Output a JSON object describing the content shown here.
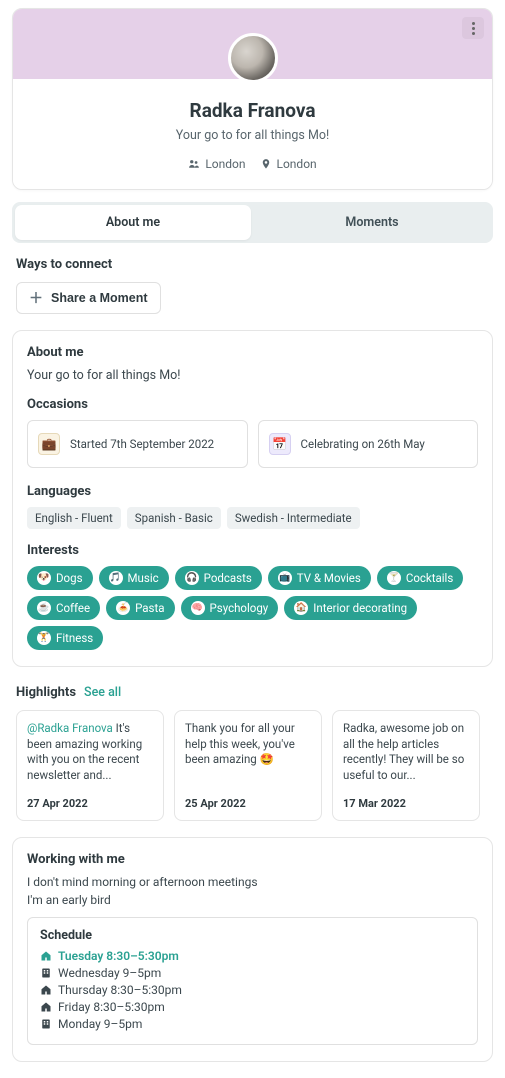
{
  "profile": {
    "name": "Radka Franova",
    "tagline": "Your go to for all things Mo!",
    "team": "London",
    "location": "London"
  },
  "tabs": {
    "about": "About me",
    "moments": "Moments"
  },
  "ways_to_connect": {
    "heading": "Ways to connect",
    "share_label": "Share a Moment"
  },
  "about": {
    "title": "About me",
    "bio": "Your go to for all things Mo!",
    "occasions_title": "Occasions",
    "occasion_started": "Started 7th September 2022",
    "occasion_celebrating": "Celebrating on 26th May",
    "languages_title": "Languages",
    "languages": [
      "English - Fluent",
      "Spanish - Basic",
      "Swedish - Intermediate"
    ],
    "interests_title": "Interests",
    "interests": [
      "Dogs",
      "Music",
      "Podcasts",
      "TV & Movies",
      "Cocktails",
      "Coffee",
      "Pasta",
      "Psychology",
      "Interior decorating",
      "Fitness"
    ]
  },
  "highlights": {
    "title": "Highlights",
    "see_all": "See all",
    "cards": [
      {
        "mention": "@Radka Franova",
        "text": "It's been amazing working with you on the recent newsletter and...",
        "date": "27 Apr 2022"
      },
      {
        "text": "Thank you for all your help this week, you've been amazing 🤩",
        "date": "25 Apr 2022"
      },
      {
        "text": "Radka, awesome job on all the help articles recently! They will be so useful to our...",
        "date": "17 Mar 2022"
      }
    ]
  },
  "working": {
    "title": "Working with me",
    "lines": [
      "I don't mind morning or afternoon meetings",
      "I'm an early bird"
    ],
    "schedule_title": "Schedule",
    "schedule": [
      {
        "day": "Tuesday",
        "hours": "8:30–5:30pm",
        "today": true,
        "mode": "home"
      },
      {
        "day": "Wednesday",
        "hours": "9–5pm",
        "today": false,
        "mode": "office"
      },
      {
        "day": "Thursday",
        "hours": "8:30–5:30pm",
        "today": false,
        "mode": "home"
      },
      {
        "day": "Friday",
        "hours": "8:30–5:30pm",
        "today": false,
        "mode": "home"
      },
      {
        "day": "Monday",
        "hours": "9–5pm",
        "today": false,
        "mode": "office"
      }
    ]
  }
}
